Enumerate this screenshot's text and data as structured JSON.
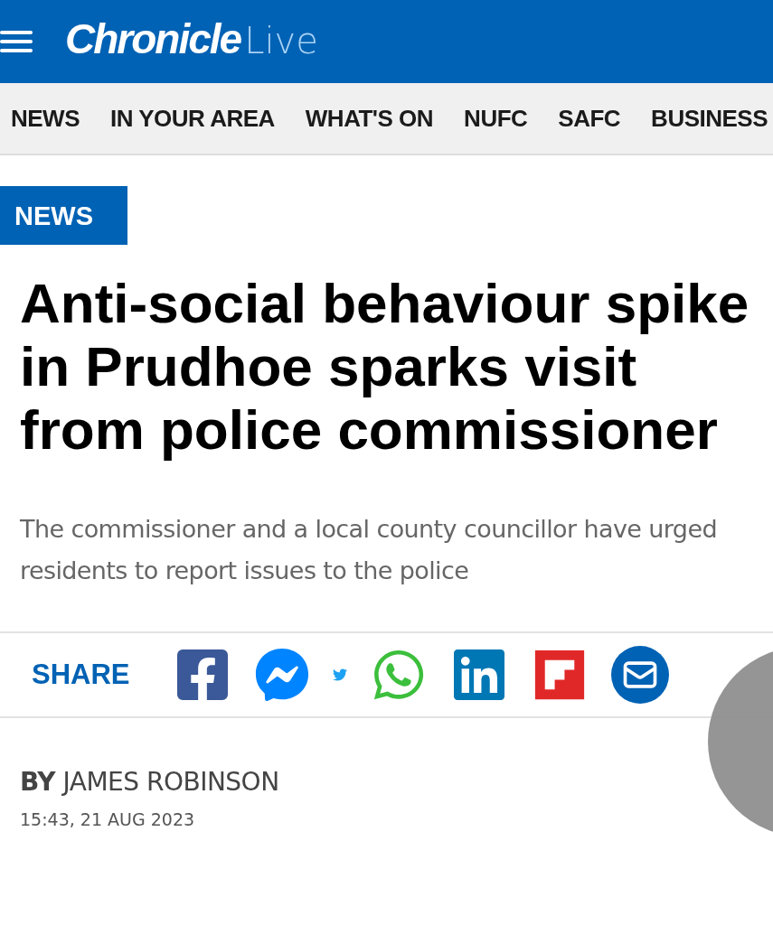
{
  "header": {
    "logo": {
      "main": "Chronicle",
      "suffix": "Live"
    }
  },
  "nav": {
    "items": [
      {
        "label": "NEWS"
      },
      {
        "label": "IN YOUR AREA"
      },
      {
        "label": "WHAT'S ON"
      },
      {
        "label": "NUFC"
      },
      {
        "label": "SAFC"
      },
      {
        "label": "BUSINESS"
      }
    ]
  },
  "article": {
    "category": "NEWS",
    "headline": "Anti-social behaviour spike in Prudhoe sparks visit from police commissioner",
    "standfirst": "The commissioner and a local county councillor have urged residents to report issues to the police",
    "share": {
      "label": "SHARE",
      "buttons": [
        {
          "kind": "facebook"
        },
        {
          "kind": "messenger"
        },
        {
          "kind": "twitter"
        },
        {
          "kind": "whatsapp"
        },
        {
          "kind": "linkedin"
        },
        {
          "kind": "flipboard"
        },
        {
          "kind": "email"
        }
      ]
    },
    "byline": "**BY** JAMES ROBINSON",
    "date": "15:43, 21 AUG 2023"
  }
}
